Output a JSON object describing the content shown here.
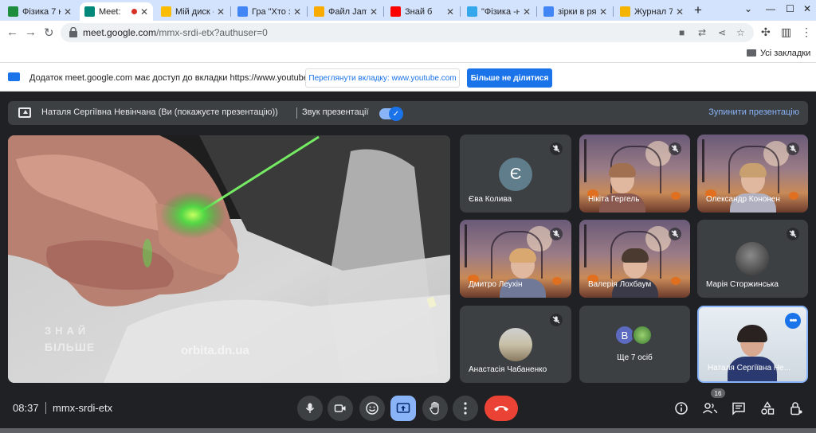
{
  "browser": {
    "tabs": [
      {
        "title": "Фізика 7 к",
        "favicon": "classroom-icon",
        "color": "#1e8e3e",
        "active": false
      },
      {
        "title": "Meet: ",
        "favicon": "meet-icon",
        "color": "#00897b",
        "active": true,
        "recording": true
      },
      {
        "title": "Мій диск -",
        "favicon": "drive-icon",
        "color": "#fbbc04",
        "active": false
      },
      {
        "title": "Гра \"Хто з",
        "favicon": "forms-icon",
        "color": "#4285f4",
        "active": false
      },
      {
        "title": "Файл Jam",
        "favicon": "hand-icon",
        "color": "#f9ab00",
        "active": false
      },
      {
        "title": "Знай б",
        "favicon": "youtube-icon",
        "color": "#ff0000",
        "active": false
      },
      {
        "title": "\"Фізика -н",
        "favicon": "app-icon",
        "color": "#34a8eb",
        "active": false
      },
      {
        "title": "зірки в ря",
        "favicon": "google-icon",
        "color": "#4285f4",
        "active": false
      },
      {
        "title": "Журнал 7",
        "favicon": "sun-icon",
        "color": "#f4b400",
        "active": false
      }
    ],
    "url_host": "meet.google.com",
    "url_path": "/mmx-srdi-etx?authuser=0",
    "bookmarks_label": "Усі закладки"
  },
  "share_notice": {
    "text": "Додаток meet.google.com має доступ до вкладки https://www.youtube.com",
    "view_tab_label": "Переглянути вкладку: www.youtube.com",
    "stop_sharing_label": "Більше не ділитися"
  },
  "presentation": {
    "presenter_text": "Наталя Сергіївна Невінчана (Ви (покажуєте презентацію))",
    "audio_label": "Звук презентації",
    "audio_on": true,
    "stop_label": "Зупинити презентацію",
    "watermark_top": "ЗНАЙ",
    "watermark_bottom": "БІЛЬШЕ",
    "watermark_site": "orbita.dn.ua"
  },
  "participants": [
    {
      "name": "Єва Колива",
      "initial": "Є",
      "avatar_color": "#607d8b",
      "muted": true,
      "type": "avatar"
    },
    {
      "name": "Нікіта Гергель",
      "muted": true,
      "type": "video"
    },
    {
      "name": "Олександр Кононен",
      "muted": true,
      "type": "video"
    },
    {
      "name": "Дмитро Леухін",
      "muted": true,
      "type": "video"
    },
    {
      "name": "Валерія Лохбаум",
      "muted": true,
      "type": "video"
    },
    {
      "name": "Марія Сторжинська",
      "muted": true,
      "type": "photo"
    },
    {
      "name": "Анастасія Чабаненко",
      "muted": true,
      "type": "photo"
    },
    {
      "name": "Ще 7 осіб",
      "initial": "В",
      "avatar_color": "#5c6bc0",
      "type": "more"
    },
    {
      "name": "Наталя Сергіївна Не...",
      "type": "self"
    }
  ],
  "controls": {
    "time": "08:37",
    "meeting_code": "mmx-srdi-etx",
    "people_count": "16"
  }
}
